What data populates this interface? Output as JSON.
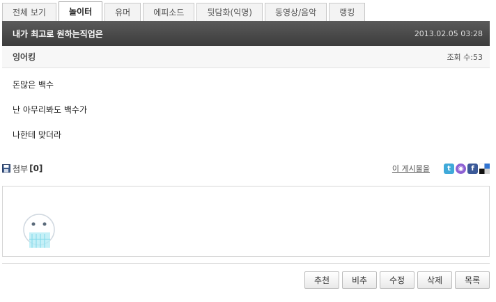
{
  "tabs": [
    {
      "label": "전체 보기"
    },
    {
      "label": "놀이터"
    },
    {
      "label": "유머"
    },
    {
      "label": "에피소드"
    },
    {
      "label": "뒷담화(익명)"
    },
    {
      "label": "동영상/음악"
    },
    {
      "label": "랭킹"
    }
  ],
  "active_tab": "놀이터",
  "post": {
    "title": "내가 최고로 원하는직업은",
    "date": "2013.02.05 03:28",
    "author": "잉어킹",
    "views": "조회 수:53",
    "lines": [
      "돈많은 백수",
      "난 아무리봐도 백수가",
      "나한테 맞더라"
    ]
  },
  "attachment": {
    "label": "첨부",
    "count": "[0]"
  },
  "share": {
    "link_text": "이 게시물을",
    "icons": [
      "twitter-icon",
      "me2day-icon",
      "facebook-icon",
      "delicious-icon"
    ]
  },
  "buttons": {
    "recommend": "추천",
    "unrecommend": "비추",
    "edit": "수정",
    "delete": "삭제",
    "list": "목록"
  },
  "colors": {
    "title_bar": "#4a4a4a",
    "twitter": "#3fa9d9",
    "me2day": "#8d5fd3",
    "facebook": "#3b5998"
  }
}
